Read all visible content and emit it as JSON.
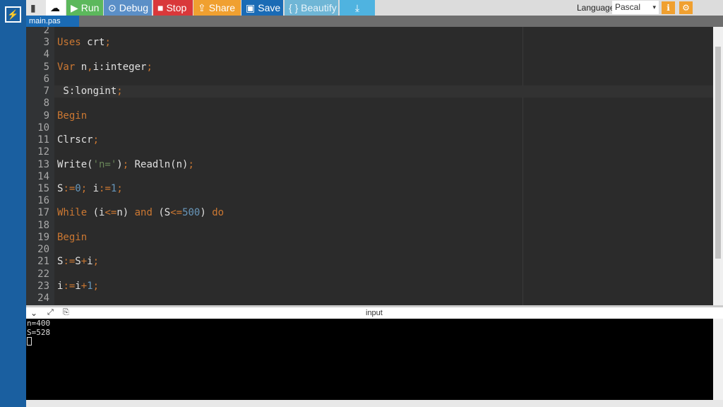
{
  "toolbar": {
    "run": "Run",
    "debug": "Debug",
    "stop": "Stop",
    "share": "Share",
    "save": "Save",
    "beautify": "{ } Beautify",
    "language_label": "Language",
    "language": "Pascal"
  },
  "tab": "main.pas",
  "code": [
    {
      "n": "2",
      "t": []
    },
    {
      "n": "3",
      "t": [
        [
          "Uses",
          "kw"
        ],
        [
          " crt",
          ""
        ],
        [
          ";",
          "op"
        ]
      ]
    },
    {
      "n": "4",
      "t": []
    },
    {
      "n": "5",
      "t": [
        [
          "Var",
          "kw"
        ],
        [
          " n",
          ""
        ],
        [
          ",",
          "op"
        ],
        [
          "i:integer",
          ""
        ],
        [
          ";",
          "op"
        ]
      ]
    },
    {
      "n": "6",
      "t": []
    },
    {
      "n": "7",
      "t": [
        [
          " S:longint",
          ""
        ],
        [
          ";",
          "op"
        ]
      ]
    },
    {
      "n": "8",
      "t": []
    },
    {
      "n": "9",
      "t": [
        [
          "Begin",
          "kw"
        ]
      ]
    },
    {
      "n": "10",
      "t": []
    },
    {
      "n": "11",
      "t": [
        [
          "Clrscr",
          ""
        ],
        [
          ";",
          "op"
        ]
      ]
    },
    {
      "n": "12",
      "t": []
    },
    {
      "n": "13",
      "t": [
        [
          "Write(",
          ""
        ],
        [
          "'n='",
          "str"
        ],
        [
          ")",
          ""
        ],
        [
          ";",
          "op"
        ],
        [
          " Readln(n)",
          ""
        ],
        [
          ";",
          "op"
        ]
      ]
    },
    {
      "n": "14",
      "t": []
    },
    {
      "n": "15",
      "t": [
        [
          "S",
          ""
        ],
        [
          ":=",
          "op"
        ],
        [
          "0",
          "num"
        ],
        [
          ";",
          "op"
        ],
        [
          " i",
          ""
        ],
        [
          ":=",
          "op"
        ],
        [
          "1",
          "num"
        ],
        [
          ";",
          "op"
        ]
      ]
    },
    {
      "n": "16",
      "t": []
    },
    {
      "n": "17",
      "t": [
        [
          "While",
          "kw"
        ],
        [
          " (i",
          ""
        ],
        [
          "<=",
          "op"
        ],
        [
          "n) ",
          ""
        ],
        [
          "and",
          "kw"
        ],
        [
          " (S",
          ""
        ],
        [
          "<=",
          "op"
        ],
        [
          "500",
          "num"
        ],
        [
          ") ",
          ""
        ],
        [
          "do",
          "kw"
        ]
      ]
    },
    {
      "n": "18",
      "t": []
    },
    {
      "n": "19",
      "t": [
        [
          "Begin",
          "kw"
        ]
      ]
    },
    {
      "n": "20",
      "t": []
    },
    {
      "n": "21",
      "t": [
        [
          "S",
          ""
        ],
        [
          ":=",
          "op"
        ],
        [
          "S",
          ""
        ],
        [
          "+",
          "op"
        ],
        [
          "i",
          ""
        ],
        [
          ";",
          "op"
        ]
      ]
    },
    {
      "n": "22",
      "t": []
    },
    {
      "n": "23",
      "t": [
        [
          "i",
          ""
        ],
        [
          ":=",
          "op"
        ],
        [
          "i",
          ""
        ],
        [
          "+",
          "op"
        ],
        [
          "1",
          "num"
        ],
        [
          ";",
          "op"
        ]
      ]
    },
    {
      "n": "24",
      "t": []
    }
  ],
  "active_line": "7",
  "output": {
    "title": "input",
    "lines": [
      "n=400",
      "S=528"
    ]
  }
}
